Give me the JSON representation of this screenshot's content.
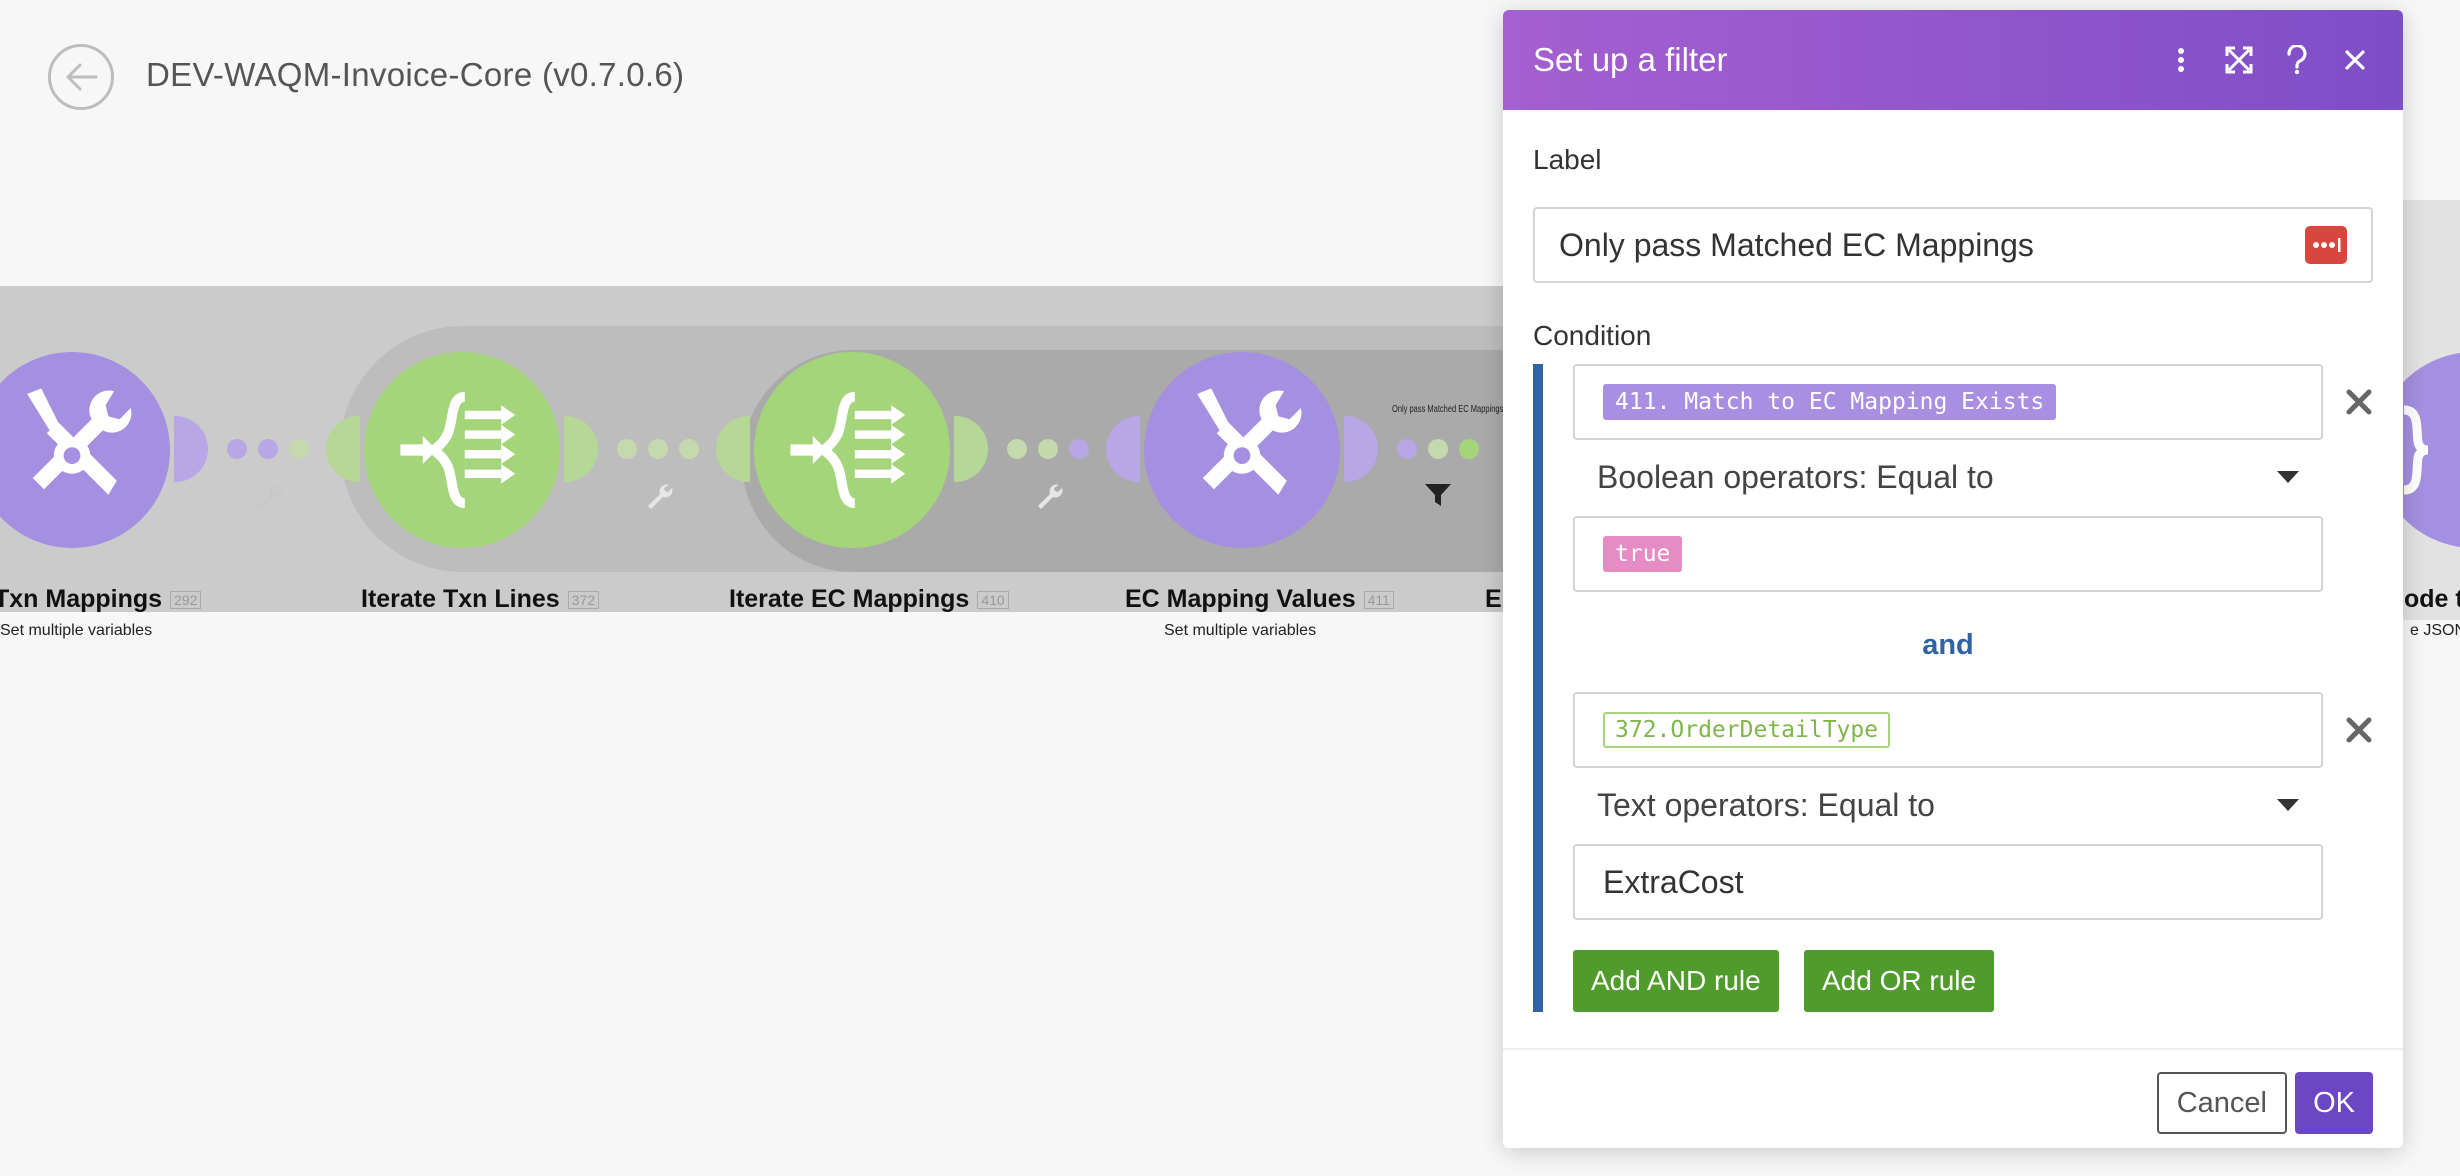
{
  "header": {
    "scenario_title": "DEV-WAQM-Invoice-Core (v0.7.0.6)"
  },
  "flow": {
    "modules": [
      {
        "label": "Txn Mappings",
        "id": "292",
        "sub": "Set multiple variables",
        "color": "#a58fe0",
        "icon": "tools-icon"
      },
      {
        "label": "Iterate Txn Lines",
        "id": "372",
        "sub": "",
        "color": "#a5d57a",
        "icon": "iterator-icon"
      },
      {
        "label": "Iterate EC Mappings",
        "id": "410",
        "sub": "",
        "color": "#a5d57a",
        "icon": "iterator-icon"
      },
      {
        "label": "EC Mapping Values",
        "id": "411",
        "sub": "Set multiple variables",
        "color": "#a58fe0",
        "icon": "tools-icon"
      }
    ],
    "filter_mini_label": "Only pass Matched EC Mappings",
    "partial_label_e": "E",
    "partial_right_label": "ode t",
    "partial_right_sub": "e JSON"
  },
  "dialog": {
    "title": "Set up a filter",
    "label_heading": "Label",
    "label_value": "Only pass Matched EC Mappings",
    "condition_heading": "Condition",
    "rules": [
      {
        "operand_a": "411. Match to EC Mapping Exists",
        "operator": "Boolean operators: Equal to",
        "operand_b": "true"
      },
      {
        "operand_a": "372.OrderDetailType",
        "operator": "Text operators: Equal to",
        "operand_b": "ExtraCost"
      }
    ],
    "and_label": "and",
    "add_and_rule": "Add AND rule",
    "add_or_rule": "Add OR rule",
    "cancel": "Cancel",
    "ok": "OK"
  },
  "colors": {
    "header_gradient_start": "#a55fd0",
    "header_gradient_end": "#7e4ec7",
    "condition_bar": "#2f63a5",
    "add_rule_button": "#4f9b2b",
    "ok_button": "#6b47c6",
    "dots_button": "#d9463e"
  }
}
